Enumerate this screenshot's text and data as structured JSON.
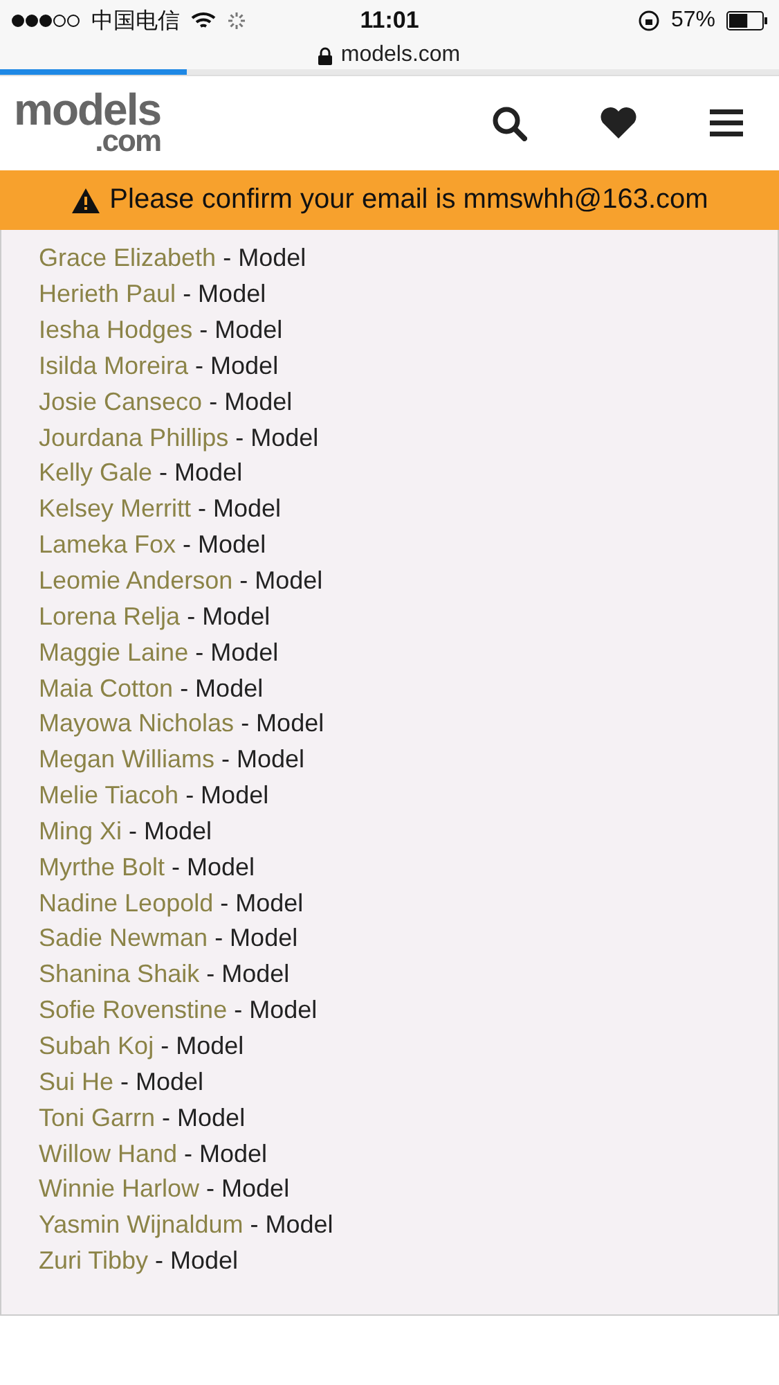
{
  "status_bar": {
    "carrier": "中国电信",
    "time": "11:01",
    "battery": "57%"
  },
  "address_bar": {
    "url": "models.com"
  },
  "load_progress": {
    "level": 0.24
  },
  "header": {
    "logo_main": "models",
    "logo_sub": ".com"
  },
  "banner": {
    "text": "Please confirm your email is mmswhh@163.com"
  },
  "list": [
    {
      "name": "Grace Elizabeth",
      "role": "- Model"
    },
    {
      "name": "Herieth Paul",
      "role": "- Model"
    },
    {
      "name": "Iesha Hodges",
      "role": "- Model"
    },
    {
      "name": "Isilda Moreira",
      "role": "- Model"
    },
    {
      "name": "Josie Canseco",
      "role": "- Model"
    },
    {
      "name": "Jourdana Phillips",
      "role": "- Model"
    },
    {
      "name": "Kelly Gale",
      "role": "- Model"
    },
    {
      "name": "Kelsey Merritt",
      "role": "- Model"
    },
    {
      "name": "Lameka Fox",
      "role": "- Model"
    },
    {
      "name": "Leomie Anderson",
      "role": "- Model"
    },
    {
      "name": "Lorena Relja",
      "role": "- Model"
    },
    {
      "name": "Maggie Laine",
      "role": "- Model"
    },
    {
      "name": "Maia Cotton",
      "role": "- Model"
    },
    {
      "name": "Mayowa Nicholas",
      "role": "- Model"
    },
    {
      "name": "Megan Williams",
      "role": "- Model"
    },
    {
      "name": "Melie Tiacoh",
      "role": "- Model"
    },
    {
      "name": "Ming Xi",
      "role": "- Model"
    },
    {
      "name": "Myrthe Bolt",
      "role": "- Model"
    },
    {
      "name": "Nadine Leopold",
      "role": "- Model"
    },
    {
      "name": "Sadie Newman",
      "role": "- Model"
    },
    {
      "name": "Shanina Shaik",
      "role": "- Model"
    },
    {
      "name": "Sofie Rovenstine",
      "role": "- Model"
    },
    {
      "name": "Subah Koj",
      "role": "- Model"
    },
    {
      "name": "Sui He",
      "role": "- Model"
    },
    {
      "name": "Toni Garrn",
      "role": "- Model"
    },
    {
      "name": "Willow Hand",
      "role": "- Model"
    },
    {
      "name": "Winnie Harlow",
      "role": "- Model"
    },
    {
      "name": "Yasmin Wijnaldum",
      "role": "- Model"
    },
    {
      "name": "Zuri Tibby",
      "role": "- Model"
    }
  ]
}
